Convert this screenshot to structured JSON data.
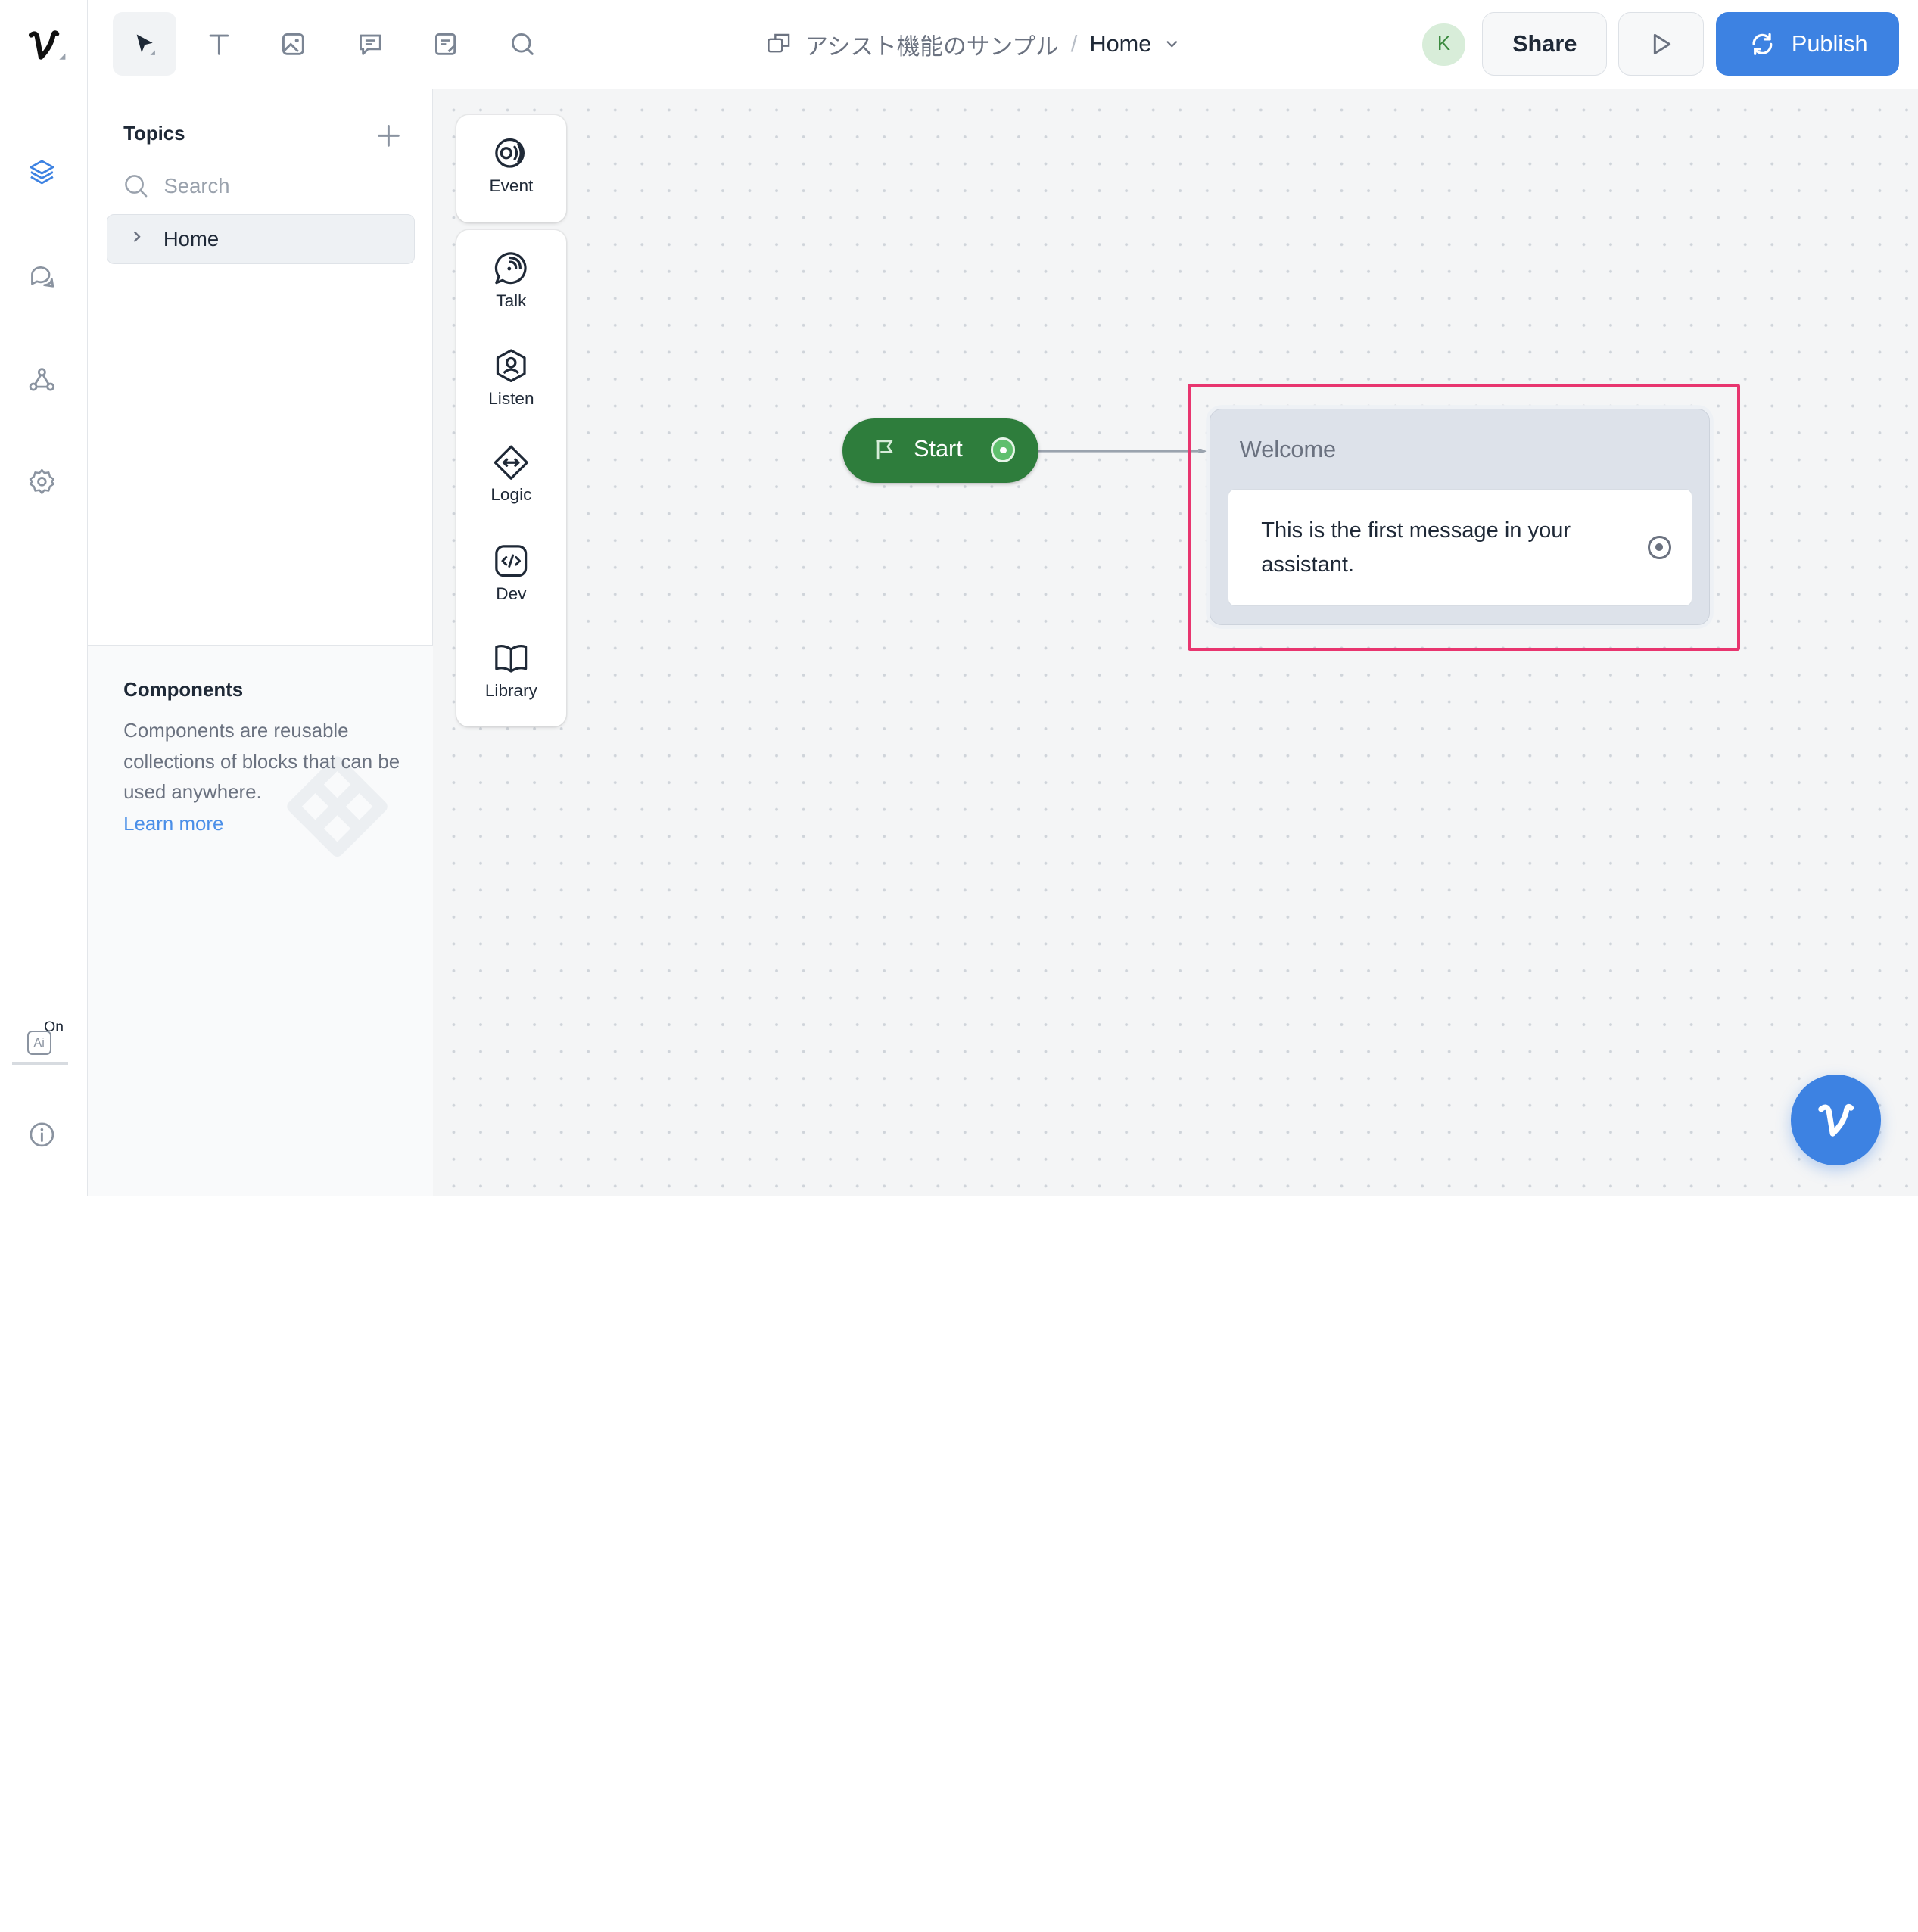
{
  "header": {
    "project_name": "アシスト機能のサンプル",
    "separator": "/",
    "current_page": "Home",
    "avatar_initial": "K",
    "share_label": "Share",
    "publish_label": "Publish"
  },
  "toolbar": {
    "tools": [
      "pointer-icon",
      "text-icon",
      "image-icon",
      "comment-icon",
      "note-icon",
      "search-icon"
    ],
    "active_tool": "pointer-icon"
  },
  "rail": {
    "items": [
      "layers-icon",
      "conversations-icon",
      "integrations-icon",
      "settings-icon"
    ],
    "active": "layers-icon",
    "ai_label": "Ai",
    "ai_state": "On"
  },
  "sidebar": {
    "topics_title": "Topics",
    "search_placeholder": "Search",
    "topics": [
      {
        "label": "Home"
      }
    ],
    "components_title": "Components",
    "components_description": "Components are reusable collections of blocks that can be used anywhere.",
    "components_link": "Learn more"
  },
  "steps": {
    "event": "Event",
    "talk": "Talk",
    "listen": "Listen",
    "logic": "Logic",
    "dev": "Dev",
    "library": "Library"
  },
  "canvas": {
    "start_label": "Start",
    "block_title": "Welcome",
    "block_message": "This is the first message in your assistant."
  },
  "colors": {
    "accent": "#3d82e2",
    "start_green": "#2e7d3c",
    "highlight": "#e8356f"
  }
}
